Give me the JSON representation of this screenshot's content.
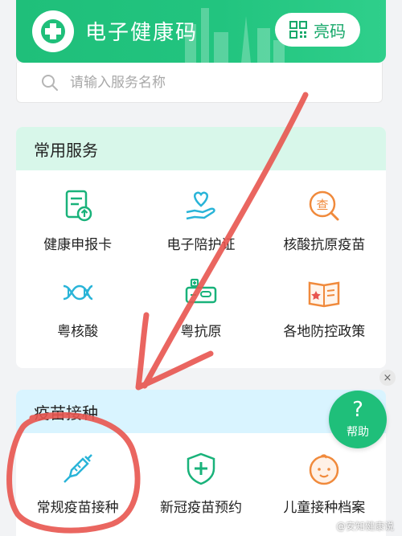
{
  "header": {
    "title": "电子健康码",
    "code_button": "亮码"
  },
  "search": {
    "placeholder": "请输入服务名称"
  },
  "common_services": {
    "title": "常用服务",
    "items": [
      {
        "label": "健康申报卡",
        "icon": "health-report-card-icon"
      },
      {
        "label": "电子陪护证",
        "icon": "escort-permit-icon"
      },
      {
        "label": "核酸抗原疫苗",
        "icon": "test-vaccine-search-icon"
      },
      {
        "label": "粤核酸",
        "icon": "dna-icon"
      },
      {
        "label": "粤抗原",
        "icon": "antigen-kit-icon"
      },
      {
        "label": "各地防控政策",
        "icon": "policy-book-icon"
      }
    ]
  },
  "vaccination": {
    "title": "疫苗接种",
    "items": [
      {
        "label": "常规疫苗接种",
        "icon": "syringe-icon"
      },
      {
        "label": "新冠疫苗预约",
        "icon": "shield-plus-icon"
      },
      {
        "label": "儿童接种档案",
        "icon": "baby-face-icon"
      }
    ]
  },
  "help_button": {
    "icon": "question-icon",
    "label": "帮助"
  },
  "close_glyph": "×",
  "watermark": "@安知健康说",
  "colors": {
    "brand_green": "#1fbf7a",
    "annotation_red": "#e8554f"
  }
}
